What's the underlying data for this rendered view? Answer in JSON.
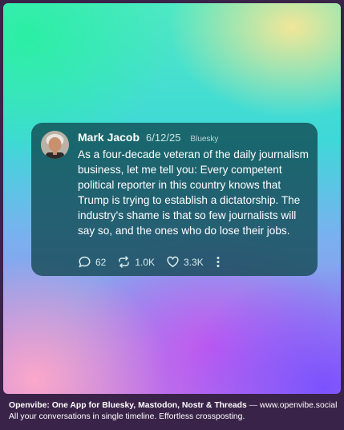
{
  "post": {
    "author": "Mark Jacob",
    "date": "6/12/25",
    "platform": "Bluesky",
    "text": "As a four-decade veteran of the daily journalism business, let me tell you: Every competent political reporter in this country knows that Trump is trying to establish a dictatorship. The industry's shame is that so few journalists will say so, and the ones who do lose their jobs.",
    "replies": "62",
    "reposts": "1.0K",
    "likes": "3.3K",
    "icons": [
      "reply-icon",
      "repost-icon",
      "like-icon",
      "more-icon"
    ]
  },
  "footer": {
    "headline": "Openvibe: One App for Bluesky, Mastodon, Nostr & Threads",
    "separator": " — ",
    "url": "www.openvibe.social",
    "tagline": "All your conversations in single timeline. Effortless crossposting."
  }
}
